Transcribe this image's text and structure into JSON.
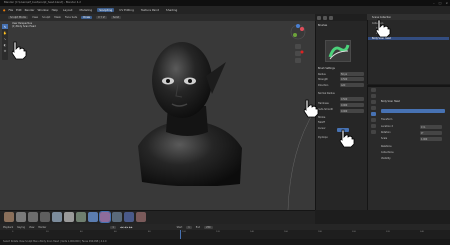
{
  "window": {
    "title": "Blender [C:\\Users\\elf_bust\\sculpt_head.blend] - Blender 4.2",
    "controls": [
      "–",
      "□",
      "×"
    ]
  },
  "menu": {
    "items": [
      "File",
      "Edit",
      "Render",
      "Window",
      "Help"
    ],
    "workspaces": [
      "Layout",
      "Modeling",
      "Sculpting",
      "UV Editing",
      "Texture Paint",
      "Shading"
    ],
    "active_workspace": "Sculpting"
  },
  "viewport_header": {
    "mode": "Sculpt Mode",
    "items": [
      "View",
      "Sculpt",
      "Mask",
      "Face Sets"
    ],
    "symmetry": "X Y Z",
    "brush_label": "Draw",
    "shading": "Solid"
  },
  "viewport_info": {
    "line1": "User Perspective",
    "line2": "(1) Body Scan Head"
  },
  "tools": [
    "brush-icon",
    "grab-icon",
    "smooth-icon",
    "mask-icon",
    "transform-icon"
  ],
  "sculpt_panel": {
    "header": "Brushes",
    "rows": [
      {
        "label": "Brush Settings",
        "value": ""
      },
      {
        "label": "Radius",
        "value": "50 px"
      },
      {
        "label": "Strength",
        "value": "0.500"
      },
      {
        "label": "Direction",
        "value": "Add"
      },
      {
        "label": "Normal Radius",
        "value": "0.500"
      },
      {
        "label": "Hardness",
        "value": "0.000"
      },
      {
        "label": "Auto-Smooth",
        "value": "0.000"
      },
      {
        "label": "Stroke",
        "value": ""
      },
      {
        "label": "Falloff",
        "value": ""
      },
      {
        "label": "Cursor",
        "value": ""
      },
      {
        "label": "Dyntopo",
        "value": ""
      }
    ]
  },
  "outliner": {
    "title": "Scene Collection",
    "rows": [
      "Collection",
      "Camera",
      "Light",
      "Body Scan Head"
    ],
    "selected_index": 3
  },
  "properties": {
    "object_name": "Body Scan Head",
    "rows": [
      {
        "label": "Transform",
        "value": ""
      },
      {
        "label": "Location X",
        "value": "0 m"
      },
      {
        "label": "Rotation",
        "value": "0°"
      },
      {
        "label": "Scale",
        "value": "1.000"
      },
      {
        "label": "Relations",
        "value": ""
      },
      {
        "label": "Collections",
        "value": ""
      },
      {
        "label": "Visibility",
        "value": ""
      }
    ]
  },
  "asset_shelf": {
    "brushes": [
      "Draw",
      "Clay",
      "Clay Strips",
      "Crease",
      "Smooth",
      "Flatten",
      "Inflate",
      "Grab",
      "Snake Hook",
      "Pinch",
      "Mask",
      "Draw Face Sets"
    ]
  },
  "timeline": {
    "items": [
      "Playback",
      "Keying",
      "View",
      "Marker"
    ],
    "start_label": "Start",
    "start": "1",
    "end_label": "End",
    "end": "250",
    "current_frame": "1",
    "ticks": [
      "0",
      "20",
      "40",
      "60",
      "80",
      "100",
      "120",
      "140",
      "160",
      "180",
      "200",
      "220",
      "240"
    ]
  },
  "status": "Select   Rotate View   Sculpt Menu   Body Scan Head | Verts 1,000,000 | Faces 999,998 | 4.2.0",
  "colors": {
    "accent": "#4772b3",
    "viewport_bg": "#393939",
    "panel_bg": "#282828"
  }
}
